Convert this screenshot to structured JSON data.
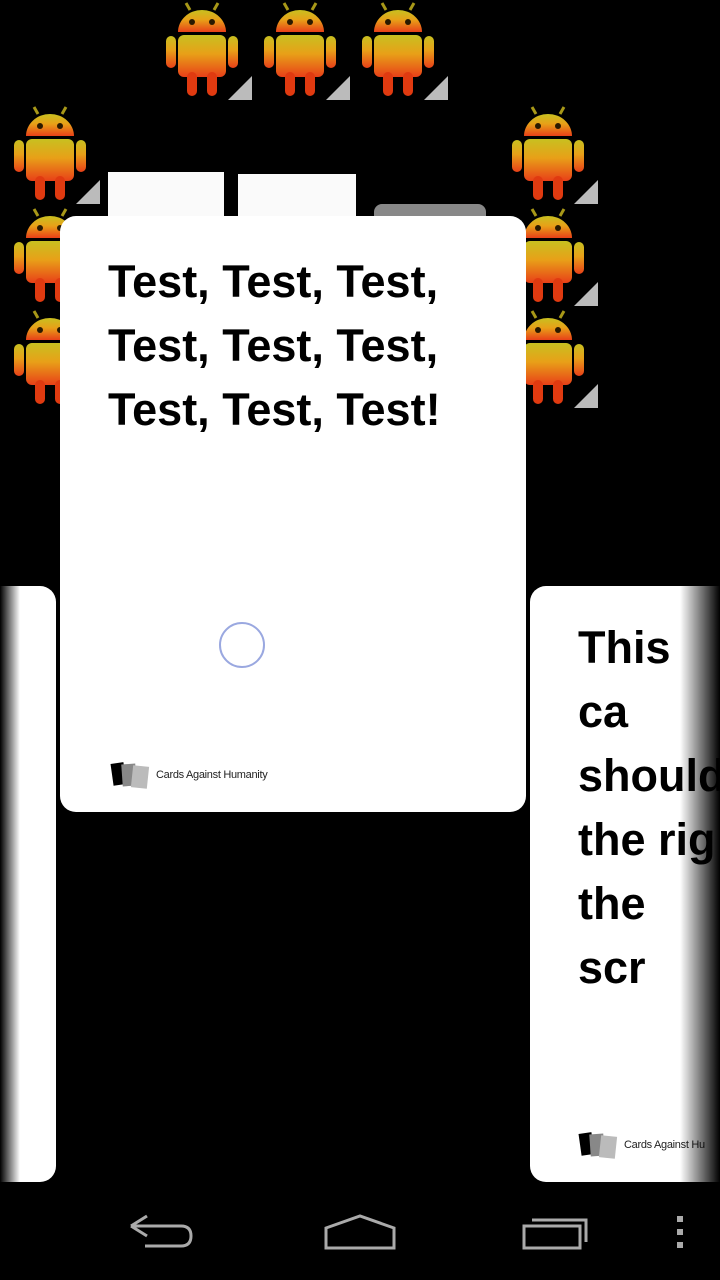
{
  "game": {
    "tile_icon": "android-robot-icon",
    "main_card": {
      "text": "Test, Test, Test,\nTest, Test, Test,\nTest, Test, Test!",
      "brand": "Cards Against Humanity"
    },
    "right_card": {
      "text": "This ca\nshould\nthe rig\nthe scr",
      "brand": "Cards Against Hu"
    }
  },
  "navbar": {
    "back_icon": "back-arrow-icon",
    "home_icon": "home-icon",
    "recents_icon": "recent-apps-icon",
    "menu_icon": "overflow-menu-icon"
  },
  "colors": {
    "background": "#000000",
    "card": "#ffffff",
    "spinner": "#9aa8e0"
  }
}
